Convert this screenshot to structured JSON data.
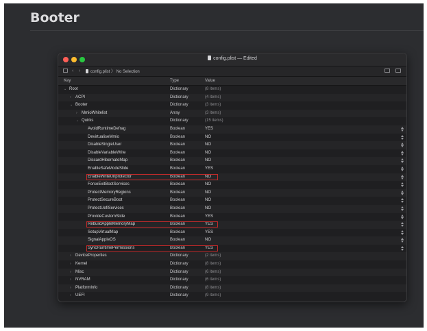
{
  "page": {
    "title": "Booter"
  },
  "window": {
    "title": "config.plist — Edited",
    "breadcrumb": {
      "file": "config.plist",
      "separator": "〉",
      "selection": "No Selection"
    }
  },
  "columns": {
    "key": "Key",
    "type": "Type",
    "value": "Value"
  },
  "rows": [
    {
      "indent": 0,
      "disclosure": "open",
      "key": "Root",
      "type": "Dictionary",
      "value": "(8 items)",
      "muted": true
    },
    {
      "indent": 1,
      "disclosure": "closed",
      "key": "ACPI",
      "type": "Dictionary",
      "value": "(4 items)",
      "muted": true
    },
    {
      "indent": 1,
      "disclosure": "open",
      "key": "Booter",
      "type": "Dictionary",
      "value": "(3 items)",
      "muted": true
    },
    {
      "indent": 2,
      "disclosure": "closed",
      "key": "MmioWhitelist",
      "type": "Array",
      "value": "(3 items)",
      "muted": true
    },
    {
      "indent": 2,
      "disclosure": "open",
      "key": "Quirks",
      "type": "Dictionary",
      "value": "(15 items)",
      "muted": true
    },
    {
      "indent": 3,
      "key": "AvoidRuntimeDefrag",
      "type": "Boolean",
      "value": "YES",
      "stepper": true
    },
    {
      "indent": 3,
      "key": "DevirtualiseMmio",
      "type": "Boolean",
      "value": "NO",
      "stepper": true
    },
    {
      "indent": 3,
      "key": "DisableSingleUser",
      "type": "Boolean",
      "value": "NO",
      "stepper": true
    },
    {
      "indent": 3,
      "key": "DisableVariableWrite",
      "type": "Boolean",
      "value": "NO",
      "stepper": true
    },
    {
      "indent": 3,
      "key": "DiscardHibernateMap",
      "type": "Boolean",
      "value": "NO",
      "stepper": true
    },
    {
      "indent": 3,
      "key": "EnableSafeModeSlide",
      "type": "Boolean",
      "value": "YES",
      "stepper": true
    },
    {
      "indent": 3,
      "key": "EnableWriteUnprotector",
      "type": "Boolean",
      "value": "NO",
      "stepper": true,
      "highlight": true
    },
    {
      "indent": 3,
      "key": "ForceExitBootServices",
      "type": "Boolean",
      "value": "NO",
      "stepper": true
    },
    {
      "indent": 3,
      "key": "ProtectMemoryRegions",
      "type": "Boolean",
      "value": "NO",
      "stepper": true
    },
    {
      "indent": 3,
      "key": "ProtectSecureBoot",
      "type": "Boolean",
      "value": "NO",
      "stepper": true
    },
    {
      "indent": 3,
      "key": "ProtectUefiServices",
      "type": "Boolean",
      "value": "NO",
      "stepper": true
    },
    {
      "indent": 3,
      "key": "ProvideCustomSlide",
      "type": "Boolean",
      "value": "YES",
      "stepper": true
    },
    {
      "indent": 3,
      "key": "RebuildAppleMemoryMap",
      "type": "Boolean",
      "value": "YES",
      "stepper": true,
      "highlight": true
    },
    {
      "indent": 3,
      "key": "SetupVirtualMap",
      "type": "Boolean",
      "value": "YES",
      "stepper": true
    },
    {
      "indent": 3,
      "key": "SignalAppleOS",
      "type": "Boolean",
      "value": "NO",
      "stepper": true
    },
    {
      "indent": 3,
      "key": "SyncRuntimePermissions",
      "type": "Boolean",
      "value": "YES",
      "stepper": true,
      "highlight": true
    },
    {
      "indent": 1,
      "disclosure": "closed",
      "key": "DeviceProperties",
      "type": "Dictionary",
      "value": "(2 items)",
      "muted": true
    },
    {
      "indent": 1,
      "disclosure": "closed",
      "key": "Kernel",
      "type": "Dictionary",
      "value": "(8 items)",
      "muted": true
    },
    {
      "indent": 1,
      "disclosure": "closed",
      "key": "Misc",
      "type": "Dictionary",
      "value": "(6 items)",
      "muted": true
    },
    {
      "indent": 1,
      "disclosure": "closed",
      "key": "NVRAM",
      "type": "Dictionary",
      "value": "(6 items)",
      "muted": true
    },
    {
      "indent": 1,
      "disclosure": "closed",
      "key": "PlatformInfo",
      "type": "Dictionary",
      "value": "(8 items)",
      "muted": true
    },
    {
      "indent": 1,
      "disclosure": "closed",
      "key": "UEFI",
      "type": "Dictionary",
      "value": "(9 items)",
      "muted": true
    }
  ],
  "icons": {
    "disclosure_open": "⌄",
    "disclosure_closed": "›",
    "nav_back": "‹",
    "nav_forward": "›"
  },
  "colors": {
    "highlight": "#c22a2a",
    "close": "#fe5f57",
    "minimize": "#febc2e",
    "zoom": "#28c840"
  }
}
